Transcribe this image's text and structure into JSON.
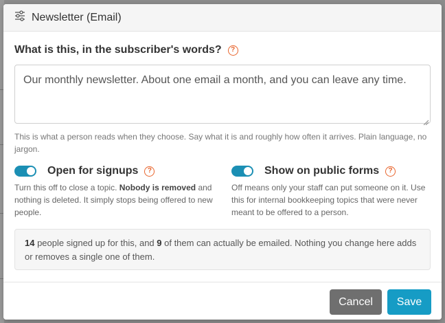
{
  "modal": {
    "title": "Newsletter (Email)",
    "icon": "sliders-icon"
  },
  "description_field": {
    "label": "What is this, in the subscriber's words?",
    "value": "Our monthly newsletter. About one email a month, and you can leave any time.",
    "hint": "This is what a person reads when they choose. Say what it is and roughly how often it arrives. Plain language, no jargon."
  },
  "toggles": {
    "signups": {
      "label": "Open for signups",
      "on": true,
      "desc_before": "Turn this off to close a topic. ",
      "desc_bold": "Nobody is removed",
      "desc_after": " and nothing is deleted. It simply stops being offered to new people."
    },
    "public_forms": {
      "label": "Show on public forms",
      "on": true,
      "desc": "Off means only your staff can put someone on it. Use this for internal bookkeeping topics that were never meant to be offered to a person."
    }
  },
  "info": {
    "signed_count": "14",
    "text_1": " people signed up for this, and ",
    "emailable_count": "9",
    "text_2": " of them can actually be emailed. Nothing you change here adds or removes a single one of them."
  },
  "footer": {
    "cancel_label": "Cancel",
    "save_label": "Save"
  },
  "colors": {
    "accent": "#169cc5",
    "toggle_on": "#1b8fb4",
    "help_icon": "#e8642c",
    "cancel": "#6f6f6f"
  }
}
